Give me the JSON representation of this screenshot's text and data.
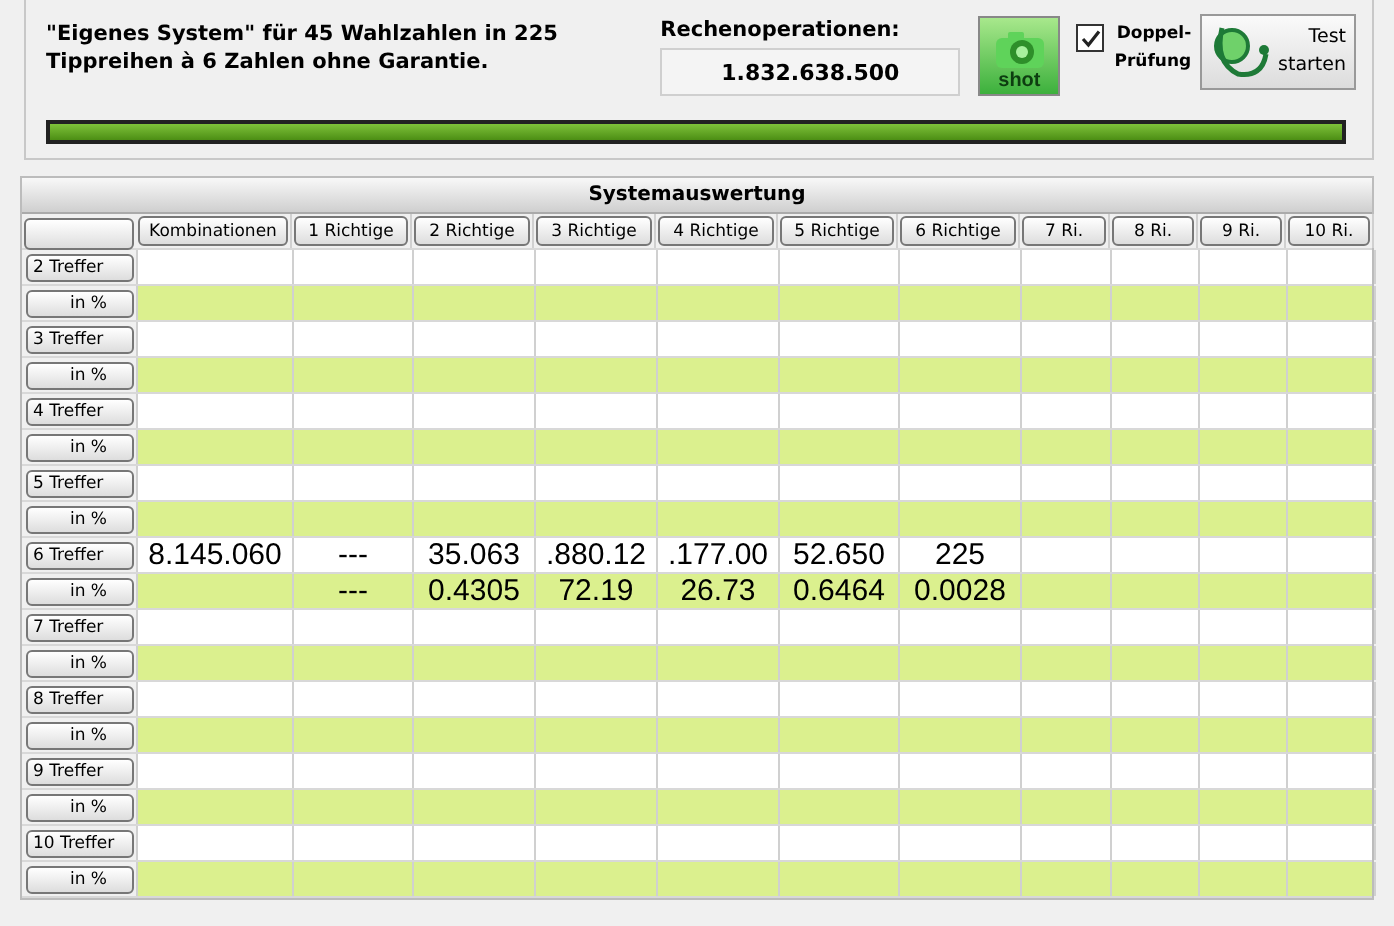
{
  "summary": {
    "line_1": "\"Eigenes System\" für 45 Wahlzahlen in 225",
    "line_2": "Tippreihen à 6 Zahlen ohne Garantie."
  },
  "operations": {
    "label": "Rechenoperationen:",
    "value": "1.832.638.500"
  },
  "shot_button": {
    "label": "shot"
  },
  "double_check": {
    "label_1": "Doppel-",
    "label_2": "Prüfung",
    "checked": true
  },
  "test_button": {
    "label_1": "Test",
    "label_2": "starten"
  },
  "progress": {
    "level": 1
  },
  "table": {
    "title": "Systemauswertung",
    "columns": [
      "Kombinationen",
      "1 Richtige",
      "2 Richtige",
      "3 Richtige",
      "4 Richtige",
      "5 Richtige",
      "6 Richtige",
      "7 Ri.",
      "8 Ri.",
      "9 Ri.",
      "10 Ri."
    ],
    "rows": [
      {
        "label": "2 Treffer",
        "kind": "count"
      },
      {
        "label": "in %",
        "kind": "percent"
      },
      {
        "label": "3 Treffer",
        "kind": "count"
      },
      {
        "label": "in %",
        "kind": "percent"
      },
      {
        "label": "4 Treffer",
        "kind": "count"
      },
      {
        "label": "in %",
        "kind": "percent"
      },
      {
        "label": "5 Treffer",
        "kind": "count"
      },
      {
        "label": "in %",
        "kind": "percent"
      },
      {
        "label": "6 Treffer",
        "kind": "count",
        "cells": [
          "8.145.060",
          "---",
          "35.063",
          ".880.12",
          ".177.00",
          "52.650",
          "225"
        ]
      },
      {
        "label": "in %",
        "kind": "percent",
        "cells": [
          null,
          "---",
          "0.4305",
          "72.19",
          "26.73",
          "0.6464",
          "0.0028"
        ]
      },
      {
        "label": "7 Treffer",
        "kind": "count"
      },
      {
        "label": "in %",
        "kind": "percent"
      },
      {
        "label": "8 Treffer",
        "kind": "count"
      },
      {
        "label": "in %",
        "kind": "percent"
      },
      {
        "label": "9 Treffer",
        "kind": "count"
      },
      {
        "label": "in %",
        "kind": "percent"
      },
      {
        "label": "10 Treffer",
        "kind": "count"
      },
      {
        "label": "in %",
        "kind": "percent"
      }
    ]
  }
}
